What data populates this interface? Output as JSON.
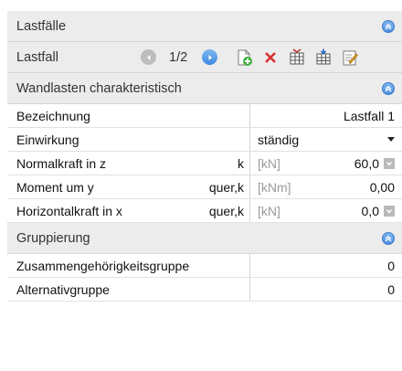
{
  "sections": {
    "lastfaelle": "Lastfälle",
    "wandlasten": "Wandlasten charakteristisch",
    "gruppierung": "Gruppierung"
  },
  "toolbar": {
    "label": "Lastfall",
    "counter": "1/2",
    "icons": [
      "new-loadcase-icon",
      "delete-icon",
      "table-icon",
      "table-import-icon",
      "edit-icon"
    ]
  },
  "rows": {
    "bezeichnung": {
      "label": "Bezeichnung",
      "value": "Lastfall 1"
    },
    "einwirkung": {
      "label": "Einwirkung",
      "value": "ständig"
    },
    "normalkraft": {
      "label": "Normalkraft in z",
      "sub": "k",
      "unit": "[kN]",
      "value": "60,0"
    },
    "moment": {
      "label": "Moment um y",
      "sub": "quer,k",
      "unit": "[kNm]",
      "value": "0,00"
    },
    "horizontalkraft": {
      "label": "Horizontalkraft in x",
      "sub": "quer,k",
      "unit": "[kN]",
      "value": "0,0"
    },
    "zusammen": {
      "label": "Zusammengehörigkeitsgruppe",
      "value": "0"
    },
    "alternativ": {
      "label": "Alternativgruppe",
      "value": "0"
    }
  },
  "colors": {
    "accent": "#4d8fe0",
    "header_bg": "#ececec",
    "unit_text": "#9a9a9a"
  }
}
